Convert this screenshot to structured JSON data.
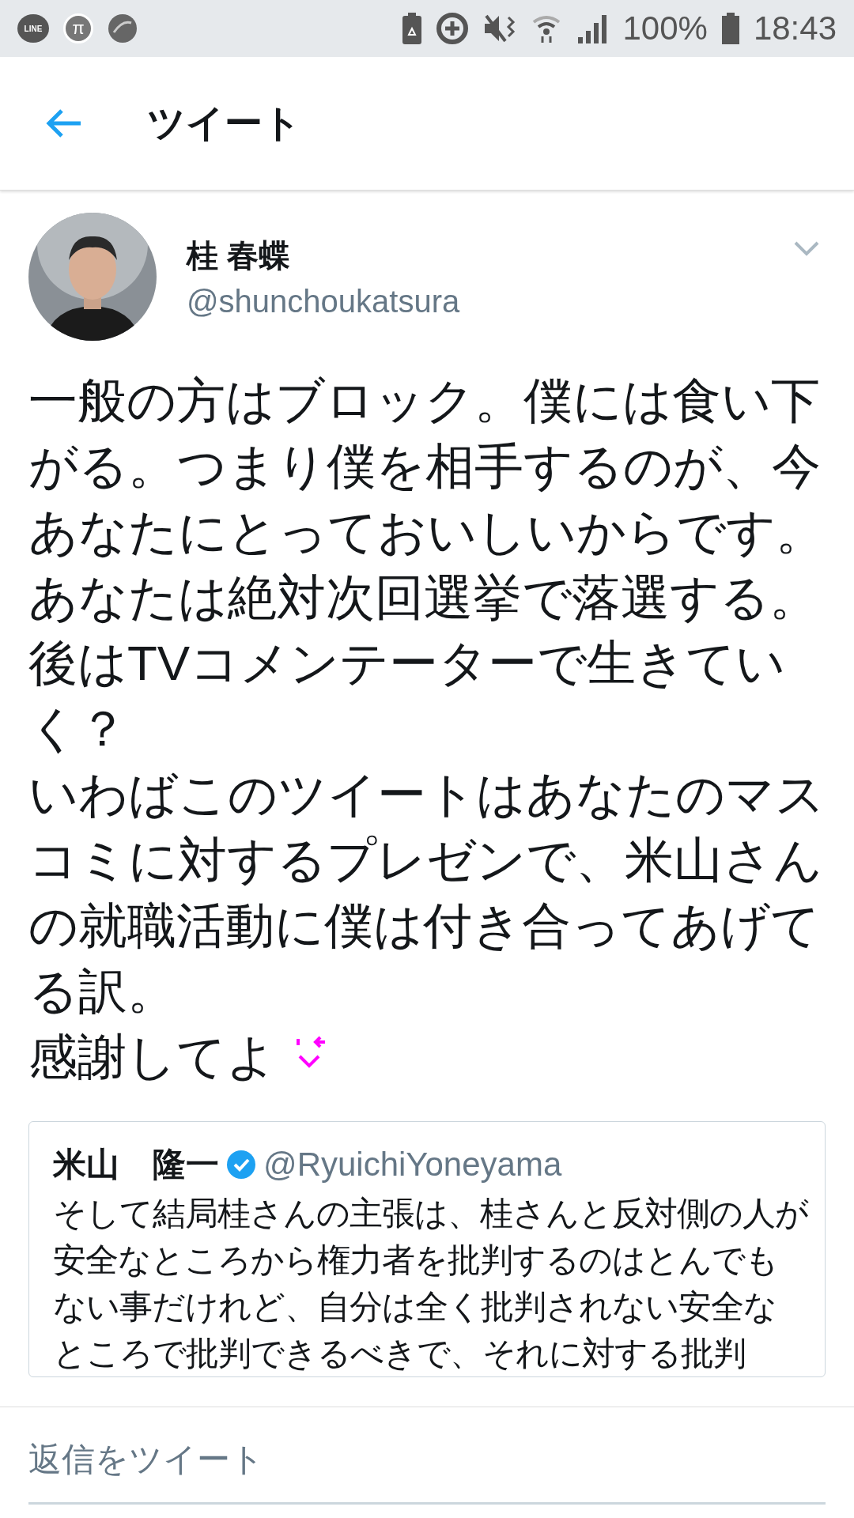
{
  "status_bar": {
    "line_app_label": "LINE",
    "pi_app_label": "π",
    "battery_percent": "100%",
    "time": "18:43"
  },
  "header": {
    "title": "ツイート"
  },
  "tweet": {
    "author_name": "桂 春蝶",
    "author_handle": "@shunchoukatsura",
    "paragraphs": [
      "一般の方はブロック。僕には食い下がる。つまり僕を相手するのが、今あなたにとっておいしいからです。",
      "あなたは絶対次回選挙で落選する。",
      "後はTVコメンテーターで生きていく？",
      "いわばこのツイートはあなたのマスコミに対するプレゼンで、米山さんの就職活動に僕は付き合ってあげてる訳。",
      "感謝してよ"
    ],
    "quoted": {
      "author_name": "米山　隆一",
      "verified": true,
      "author_handle": "@RyuichiYoneyama",
      "text": "そして結局桂さんの主張は、桂さんと反対側の人が安全なところから権力者を批判するのはとんでもない事だけれど、自分は全く批判されない安全なところで批判できるべきで、それに対する批判"
    }
  },
  "reply_bar": {
    "placeholder": "返信をツイート"
  }
}
